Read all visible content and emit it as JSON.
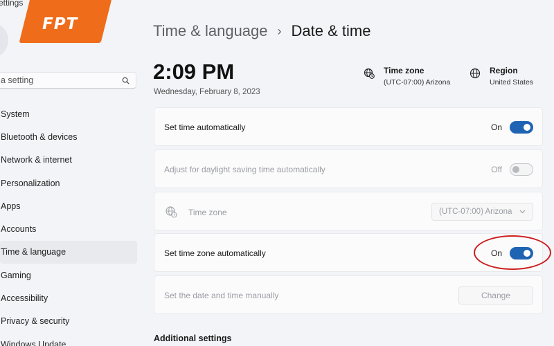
{
  "app": {
    "title": "ettings"
  },
  "logo": {
    "text": "FPT"
  },
  "sidebar": {
    "search_value": "a setting",
    "items": [
      {
        "label": "System"
      },
      {
        "label": "Bluetooth & devices"
      },
      {
        "label": "Network & internet"
      },
      {
        "label": "Personalization"
      },
      {
        "label": "Apps"
      },
      {
        "label": "Accounts"
      },
      {
        "label": "Time & language"
      },
      {
        "label": "Gaming"
      },
      {
        "label": "Accessibility"
      },
      {
        "label": "Privacy & security"
      },
      {
        "label": "Windows Update"
      }
    ],
    "active_index": 6
  },
  "header": {
    "breadcrumb_parent": "Time & language",
    "breadcrumb_separator": "›",
    "breadcrumb_current": "Date & time"
  },
  "clock": {
    "time": "2:09 PM",
    "date": "Wednesday, February 8, 2023"
  },
  "info": {
    "time_zone_title": "Time zone",
    "time_zone_value": "(UTC-07:00) Arizona",
    "region_title": "Region",
    "region_value": "United States"
  },
  "settings": {
    "set_time_auto": {
      "label": "Set time automatically",
      "state": "On"
    },
    "daylight": {
      "label": "Adjust for daylight saving time automatically",
      "state": "Off"
    },
    "time_zone": {
      "label": "Time zone",
      "selected": "(UTC-07:00) Arizona"
    },
    "set_tz_auto": {
      "label": "Set time zone automatically",
      "state": "On"
    },
    "manual": {
      "label": "Set the date and time manually",
      "button": "Change"
    }
  },
  "additional": {
    "heading": "Additional settings"
  },
  "colors": {
    "accent": "#1f63b3",
    "highlight": "#cc1f1f",
    "logo": "#ef6c1a"
  }
}
